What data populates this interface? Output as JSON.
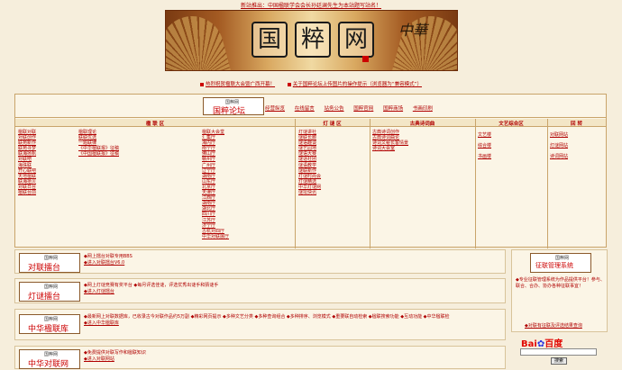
{
  "top_notice": "新站推出：中国楹联学会会长孙廷澜先生为本站题写站名！",
  "banner": {
    "title_chars": [
      "国",
      "粹",
      "网"
    ],
    "brush_text": "中華"
  },
  "hot_links": [
    "热烈祝贺楹联大会暨广西开幕！",
    "关于国粹论坛上传图片的操作提示（浏览器为“兼容模式”）"
  ],
  "nav": {
    "logo_small": "国粹网",
    "logo_big": "国粹论坛",
    "links": [
      "经营纵览",
      "在线留言",
      "站务公告",
      "国粹官网",
      "国粹商场",
      "书画印刷"
    ]
  },
  "columns": {
    "headers": [
      "楹 联 区",
      "灯 谜 区",
      "古典诗词曲",
      "文艺综合区",
      "回 转"
    ],
    "col1": [
      "楹联对联",
      "对联创作",
      "联苑新作",
      "联苑寻梦",
      "联海扬帆",
      "对联吧",
      "海珠联",
      "开心联吧",
      "天地楹联",
      "联海拾贝",
      "对联日台",
      "楹联台前"
    ],
    "col2": [
      "楹联理论",
      "联联优选",
      "一题联律",
      "《中华楹联报》征稿",
      "《中国楹联报》征稿"
    ],
    "col3": [
      "楹联大会堂",
      "汇集厅",
      "海内厅",
      "南宁厅",
      "佛山厅",
      "赣州厅",
      "广州厅",
      "辽宁厅",
      "湖南厅",
      "山东厅",
      "北京厅",
      "天津厅",
      "江西厅",
      "湖南厅",
      "湖北厅",
      "四川厅",
      "江苏厅",
      "济宁厅",
      "古杭对四厅",
      "中华对联展厅"
    ],
    "col4": [
      "灯谜讲社",
      "谜联长廊",
      "谜语趣谈",
      "谜艺园地",
      "谜语大赛",
      "谜话社团",
      "谜语教学",
      "谜联新作",
      "灯谜时尚会",
      "灯谜精选",
      "中华灯谜网",
      "谜坛快讯"
    ],
    "col5": [
      "古典诗词创作",
      "古典诗词曲论",
      "诗词文秘长客情景",
      "诗词大会室"
    ],
    "col6": [
      "文艺楼",
      "综合楼",
      "书画楼"
    ],
    "col7": [
      "对联网站",
      "灯谜网站",
      "诗词网站"
    ]
  },
  "panels": [
    {
      "logo_small": "国粹网",
      "logo_big": "对联擂台",
      "lines": [
        "◆网上擂台对联专用BBS",
        "◆进入对联擂台V6.0"
      ]
    },
    {
      "logo_small": "国粹网",
      "logo_big": "灯谜擂台",
      "lines": [
        "◆网上灯谜竞赛有奖平台    ◆每月评选佳谜，评选优秀出谜手和猜谜手",
        "◆进入灯谜擂台"
      ]
    },
    {
      "logo_small": "国粹网",
      "logo_big": "中华楹联库",
      "lines": [
        "◆最新网上对联数据库，已收录古今对联作品约5万副  ◆精彩网页提示  ◆多种文艺分类  ◆多种查询组合  ◆多种排序、浏览模式  ◆重要联自动检索  ◆楹联搜索功能  ◆互动功能  ◆中华楹联检",
        "◆进入中华楹联库"
      ]
    },
    {
      "logo_small": "国粹网",
      "logo_big": "中华对联网",
      "lines": [
        "◆免费提供对联写作和楹联知识",
        "◆进入对联网站"
      ]
    }
  ],
  "side": {
    "logo_small": "国粹网",
    "logo_big": "征联管理系统",
    "desc": "◆专业征联管理系统为作品提供平台！参与、联合、合办、协办各种征联事宜！",
    "link": "◆对联有征联及评选结果查询",
    "search_brand_a": "Bai",
    "search_brand_b": "du",
    "search_brand_c": "百度",
    "search_button": "搜索"
  }
}
